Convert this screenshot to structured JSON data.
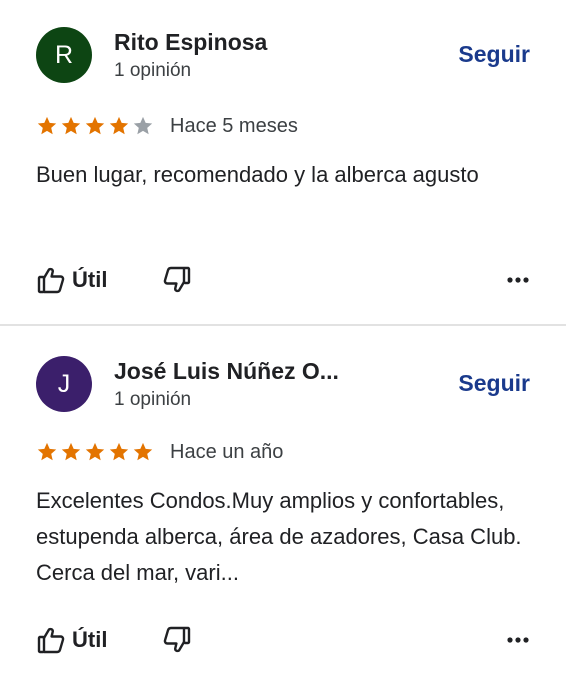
{
  "reviews": [
    {
      "avatar_letter": "R",
      "avatar_color": "#0d4513",
      "name": "Rito Espinosa",
      "review_count": "1 opinión",
      "follow_label": "Seguir",
      "rating": 4,
      "max_rating": 5,
      "date": "Hace 5 meses",
      "text": "Buen lugar, recomendado  y la alberca agusto",
      "useful_label": "Útil"
    },
    {
      "avatar_letter": "J",
      "avatar_color": "#3b1f6b",
      "name": "José Luis Núñez O...",
      "review_count": "1 opinión",
      "follow_label": "Seguir",
      "rating": 5,
      "max_rating": 5,
      "date": "Hace un año",
      "text": "Excelentes Condos.Muy amplios y confortables, estupenda alberca, área de azadores, Casa Club.  Cerca del mar, vari...",
      "useful_label": "Útil"
    }
  ],
  "colors": {
    "star_filled": "#e37400",
    "star_empty": "#9aa0a6",
    "follow": "#1a3a8c"
  },
  "icons": {
    "useful": "thumbs-up-icon",
    "dislike": "thumbs-down-icon",
    "more": "more-horizontal-icon"
  }
}
